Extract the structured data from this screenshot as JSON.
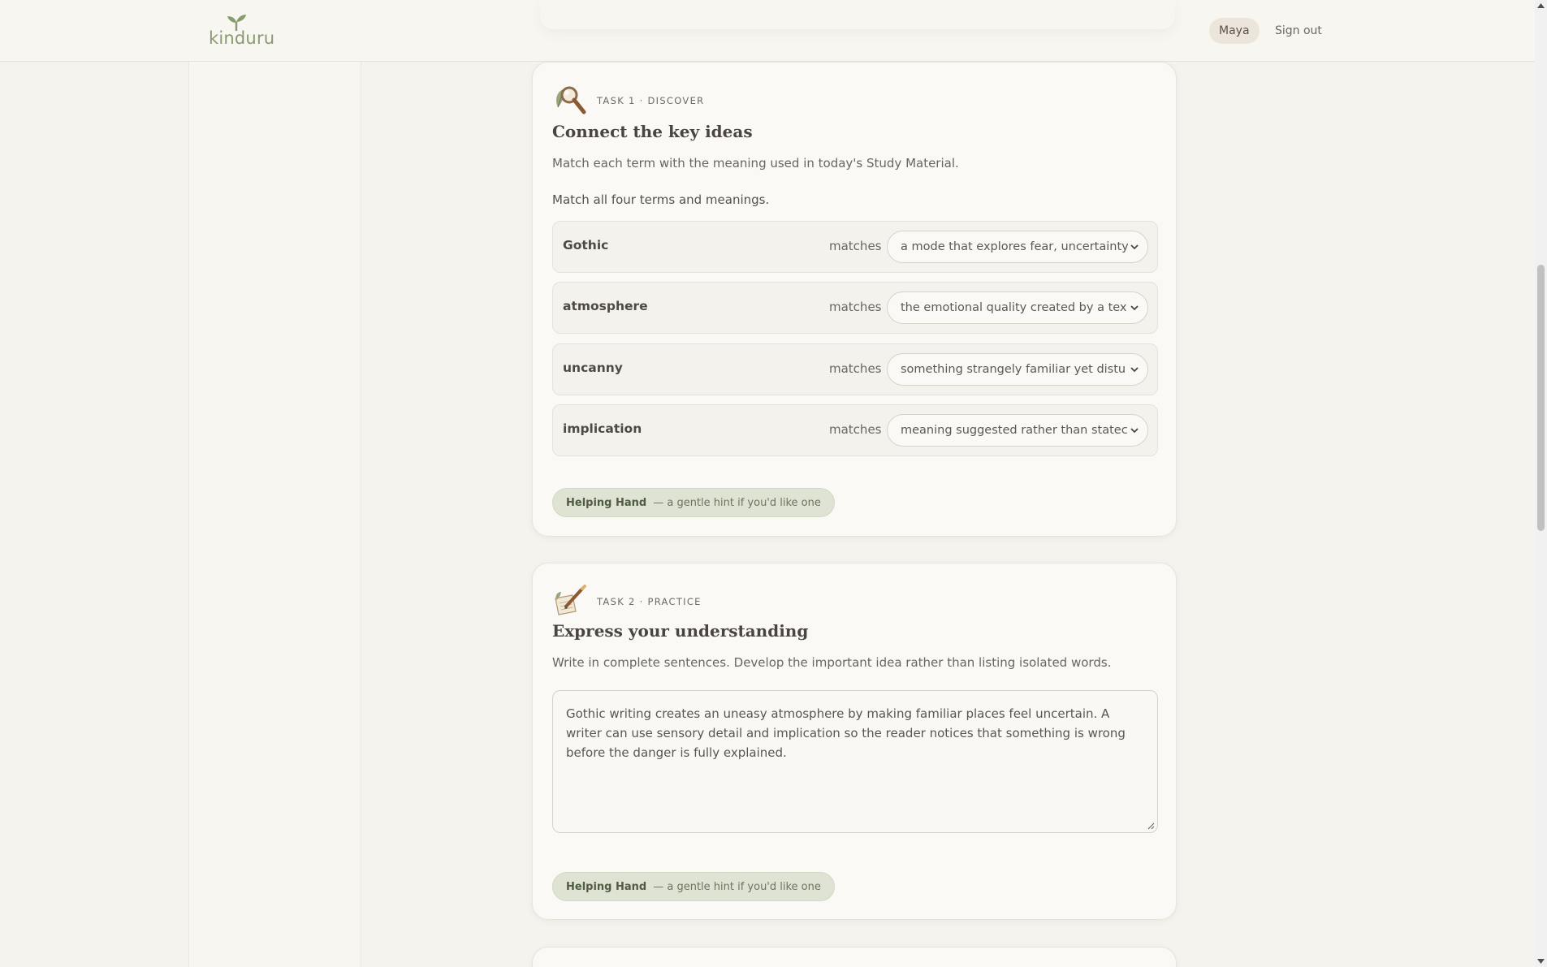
{
  "header": {
    "logo_text": "kinduru",
    "user_name": "Maya",
    "signout_label": "Sign out"
  },
  "task1": {
    "label": "TASK 1 · DISCOVER",
    "icon": "magnifier-leaf-icon",
    "title": "Connect the key ideas",
    "description": "Match each term with the meaning used in today's Study Material.",
    "instruction": "Match all four terms and meanings.",
    "matches_word": "matches",
    "rows": [
      {
        "term": "Gothic",
        "value": "a mode that explores fear, uncertainty"
      },
      {
        "term": "atmosphere",
        "value": "the emotional quality created by a tex"
      },
      {
        "term": "uncanny",
        "value": "something strangely familiar yet distu"
      },
      {
        "term": "implication",
        "value": "meaning suggested rather than statec"
      }
    ],
    "hint": {
      "title": "Helping Hand",
      "subtitle": "— a gentle hint if you'd like one"
    }
  },
  "task2": {
    "label": "TASK 2 · PRACTICE",
    "icon": "pencil-notepad-icon",
    "title": "Express your understanding",
    "description": "Write in complete sentences. Develop the important idea rather than listing isolated words.",
    "answer": "Gothic writing creates an uneasy atmosphere by making familiar places feel uncertain. A writer can use sensory detail and implication so the reader notices that something is wrong before the danger is fully explained.",
    "hint": {
      "title": "Helping Hand",
      "subtitle": "— a gentle hint if you'd like one"
    }
  },
  "colors": {
    "background": "#f5f3ee",
    "card": "#faf9f5",
    "accent_green": "#8a9a6f",
    "hint_bg": "#dfe3d3"
  }
}
